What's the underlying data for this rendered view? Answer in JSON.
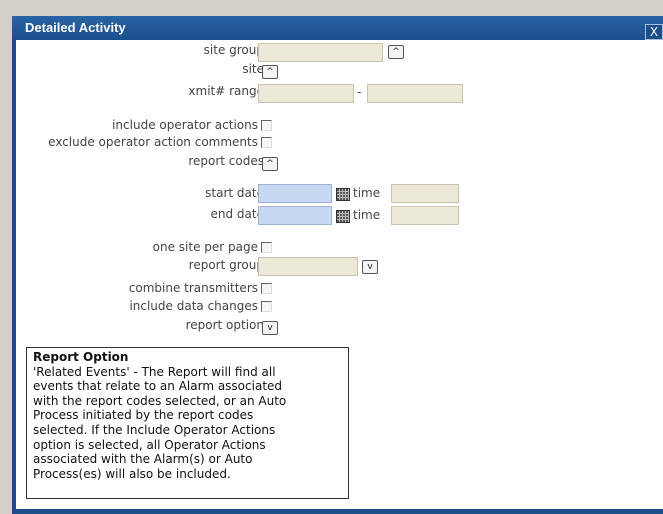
{
  "dialog": {
    "title": "Detailed Activity",
    "close_label": "X"
  },
  "labels": {
    "site_group": "site group",
    "site": "site",
    "xmit_range": "xmit# range",
    "range_separator": "-",
    "include_operator_actions": "include operator actions",
    "exclude_operator_action_comments": "exclude operator action comments",
    "report_codes": "report codes",
    "start_date": "start date",
    "end_date": "end date",
    "time": "time",
    "one_site_per_page": "one site per page",
    "report_group": "report group",
    "combine_transmitters": "combine transmitters",
    "include_data_changes": "include data changes",
    "report_option": "report option"
  },
  "icons": {
    "expand_up": "^",
    "dropdown": "v"
  },
  "tooltip": {
    "title": "Report Option",
    "lines": [
      "'Related Events' - The Report will find all",
      "events that relate to an Alarm associated",
      "with the report codes selected, or an Auto",
      "Process initiated by the report codes",
      "selected. If the Include Operator Actions",
      "option is selected, all Operator Actions",
      "associated with the Alarm(s) or Auto",
      "Process(es) will also be included."
    ]
  },
  "colors": {
    "titlebar": "#1a4f8b",
    "date_field": "#c6d8f2",
    "field": "#ece9d8"
  }
}
